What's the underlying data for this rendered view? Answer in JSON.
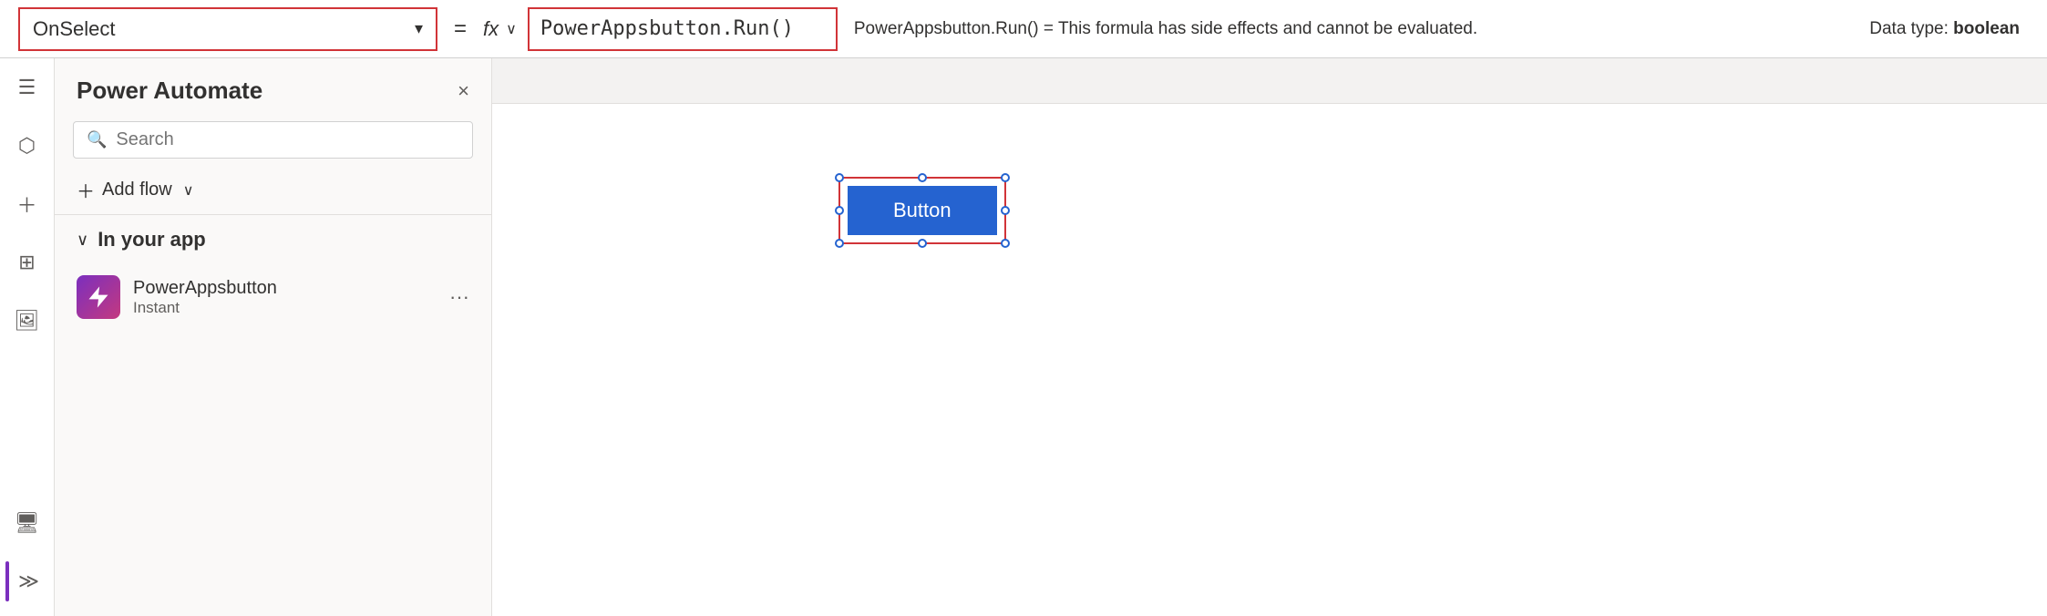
{
  "formula_bar": {
    "property_label": "OnSelect",
    "equals": "=",
    "fx_label": "fx",
    "formula_value": "PowerAppsbutton.Run()",
    "info_text": "PowerAppsbutton.Run()  =  This formula has side effects and cannot be evaluated.",
    "data_type_label": "Data type:",
    "data_type_value": "boolean"
  },
  "sidebar": {
    "icons": [
      "≡",
      "⬡",
      "+",
      "⊞",
      "🖥"
    ]
  },
  "pa_panel": {
    "title": "Power Automate",
    "close_label": "×",
    "search_placeholder": "Search",
    "add_flow_label": "Add flow",
    "in_your_app_label": "In your app",
    "flows": [
      {
        "name": "PowerAppsbutton",
        "type": "Instant",
        "more_icon": "···"
      }
    ]
  },
  "canvas": {
    "button_label": "Button"
  }
}
